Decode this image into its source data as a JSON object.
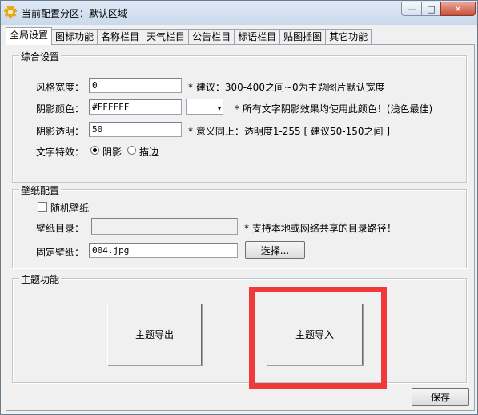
{
  "window": {
    "title": "当前配置分区：默认区域",
    "minimize_glyph": "—",
    "maximize_glyph": "□",
    "close_glyph": "✕"
  },
  "tabs": [
    "全局设置",
    "图标功能",
    "名称栏目",
    "天气栏目",
    "公告栏目",
    "标语栏目",
    "贴图插图",
    "其它功能"
  ],
  "general": {
    "group_label": "综合设置",
    "style_width": {
      "label": "风格宽度：",
      "value": "0",
      "hint": "* 建议：300-400之间~0为主题图片默认宽度"
    },
    "shadow_color": {
      "label": "阴影颜色：",
      "value": "#FFFFFF",
      "hint": "* 所有文字阴影效果均使用此颜色！(浅色最佳)"
    },
    "shadow_opacity": {
      "label": "阴影透明：",
      "value": "50",
      "hint": "* 意义同上：透明度1-255 [ 建议50-150之间 ]"
    },
    "text_effect": {
      "label": "文字特效：",
      "option_shadow": "阴影",
      "option_stroke": "描边",
      "selected": "阴影"
    }
  },
  "wallpaper": {
    "group_label": "壁纸配置",
    "random_label": "随机壁纸",
    "random_checked": false,
    "dir_label": "壁纸目录：",
    "dir_value": "",
    "dir_hint": "* 支持本地或网络共享的目录路径！",
    "fixed_label": "固定壁纸：",
    "fixed_value": "004.jpg",
    "browse_label": "选择..."
  },
  "theme": {
    "group_label": "主题功能",
    "export_label": "主题导出",
    "import_label": "主题导入"
  },
  "save_label": "保存",
  "colors": {
    "highlight": "#f03a3a"
  }
}
